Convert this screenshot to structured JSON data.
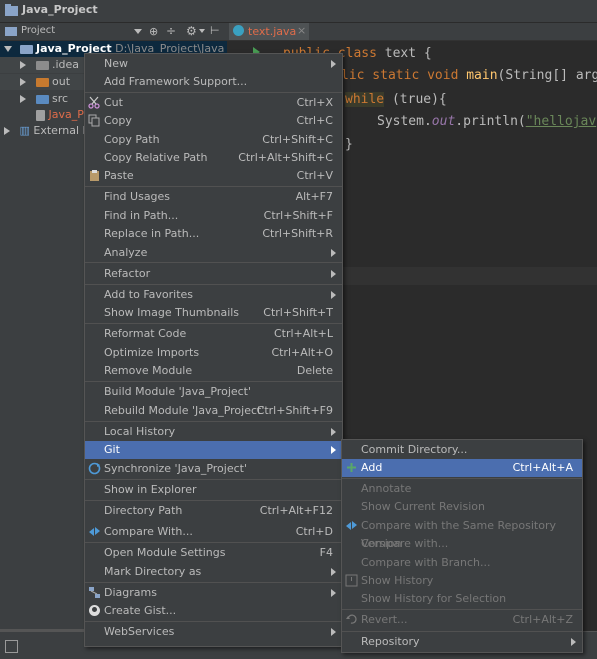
{
  "window": {
    "title": "Java_Project"
  },
  "project_panel": {
    "header_label": "Project",
    "tree": [
      {
        "label": "Java_Project",
        "suffix": "D:\\Java_Project\\Java_Proje"
      },
      {
        "label": ".idea"
      },
      {
        "label": "out"
      },
      {
        "label": "src"
      },
      {
        "label": "Java_Pr"
      },
      {
        "label": "External Li"
      }
    ]
  },
  "editor": {
    "tab_label": "text.java",
    "code": {
      "l1_kw": "public class",
      "l1_rest": " text {",
      "l2_kw": "lic static void ",
      "l2_fn": "main",
      "l2_rest": "(String[] arg",
      "l3_kw": "while",
      "l3_rest": " (true){",
      "l4_a": "System.",
      "l4_field": "out",
      "l4_b": ".println(",
      "l4_str": "\"hellojav",
      "l5": "}"
    }
  },
  "context_menu": {
    "items": [
      {
        "label": "New",
        "shortcut": "",
        "submenu": true
      },
      {
        "label": "Add Framework Support...",
        "shortcut": ""
      },
      {
        "label": "Cut",
        "shortcut": "Ctrl+X",
        "icon": "scissors-icon"
      },
      {
        "label": "Copy",
        "shortcut": "Ctrl+C",
        "icon": "copy-icon"
      },
      {
        "label": "Copy Path",
        "shortcut": "Ctrl+Shift+C"
      },
      {
        "label": "Copy Relative Path",
        "shortcut": "Ctrl+Alt+Shift+C"
      },
      {
        "label": "Paste",
        "shortcut": "Ctrl+V",
        "icon": "paste-icon"
      },
      {
        "label": "Find Usages",
        "shortcut": "Alt+F7"
      },
      {
        "label": "Find in Path...",
        "shortcut": "Ctrl+Shift+F"
      },
      {
        "label": "Replace in Path...",
        "shortcut": "Ctrl+Shift+R"
      },
      {
        "label": "Analyze",
        "shortcut": "",
        "submenu": true
      },
      {
        "label": "Refactor",
        "shortcut": "",
        "submenu": true
      },
      {
        "label": "Add to Favorites",
        "shortcut": "",
        "submenu": true
      },
      {
        "label": "Show Image Thumbnails",
        "shortcut": "Ctrl+Shift+T"
      },
      {
        "label": "Reformat Code",
        "shortcut": "Ctrl+Alt+L"
      },
      {
        "label": "Optimize Imports",
        "shortcut": "Ctrl+Alt+O"
      },
      {
        "label": "Remove Module",
        "shortcut": "Delete"
      },
      {
        "label": "Build Module 'Java_Project'",
        "shortcut": ""
      },
      {
        "label": "Rebuild Module 'Java_Project'",
        "shortcut": "Ctrl+Shift+F9"
      },
      {
        "label": "Local History",
        "shortcut": "",
        "submenu": true
      },
      {
        "label": "Git",
        "shortcut": "",
        "submenu": true,
        "selected": true
      },
      {
        "label": "Synchronize 'Java_Project'",
        "shortcut": "",
        "icon": "sync-icon"
      },
      {
        "label": "Show in Explorer",
        "shortcut": ""
      },
      {
        "label": "Directory Path",
        "shortcut": "Ctrl+Alt+F12"
      },
      {
        "label": "Compare With...",
        "shortcut": "Ctrl+D",
        "icon": "compare-icon"
      },
      {
        "label": "Open Module Settings",
        "shortcut": "F4"
      },
      {
        "label": "Mark Directory as",
        "shortcut": "",
        "submenu": true
      },
      {
        "label": "Diagrams",
        "shortcut": "",
        "submenu": true,
        "icon": "diagram-icon"
      },
      {
        "label": "Create Gist...",
        "shortcut": "",
        "icon": "github-icon"
      },
      {
        "label": "WebServices",
        "shortcut": "",
        "submenu": true
      }
    ]
  },
  "git_submenu": {
    "items": [
      {
        "label": "Commit Directory...",
        "shortcut": ""
      },
      {
        "label": "Add",
        "shortcut": "Ctrl+Alt+A",
        "selected": true,
        "icon": "plus-icon"
      },
      {
        "label": "Annotate",
        "shortcut": "",
        "disabled": true
      },
      {
        "label": "Show Current Revision",
        "shortcut": "",
        "disabled": true
      },
      {
        "label": "Compare with the Same Repository Version",
        "shortcut": "",
        "disabled": true,
        "icon": "compare-icon"
      },
      {
        "label": "Compare with...",
        "shortcut": "",
        "disabled": true
      },
      {
        "label": "Compare with Branch...",
        "shortcut": "",
        "disabled": true
      },
      {
        "label": "Show History",
        "shortcut": "",
        "disabled": true,
        "icon": "history-icon"
      },
      {
        "label": "Show History for Selection",
        "shortcut": "",
        "disabled": true
      },
      {
        "label": "Revert...",
        "shortcut": "Ctrl+Alt+Z",
        "disabled": true,
        "icon": "revert-icon"
      },
      {
        "label": "Repository",
        "shortcut": "",
        "submenu": true
      }
    ]
  },
  "colors": {
    "selection": "#4b6eaf",
    "panel": "#3c3f41",
    "editor": "#2b2b2b"
  }
}
